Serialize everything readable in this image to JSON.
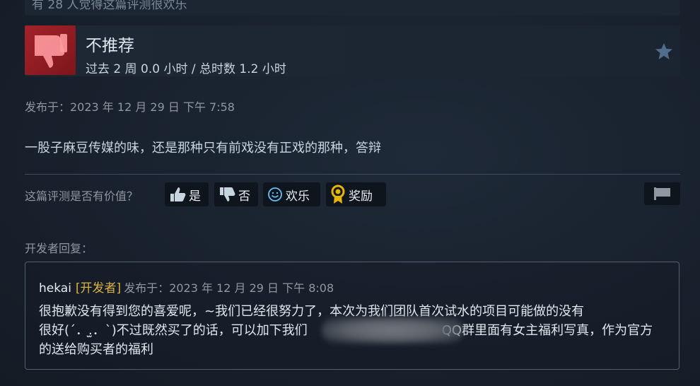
{
  "top_strip_text": "有 28 人觉得这篇评测很欢乐",
  "review": {
    "verdict": "不推荐",
    "hours": "过去 2 周 0.0 小时 / 总时数 1.2 小时",
    "posted": "发布于：2023 年 12 月 29 日 下午 7:58",
    "text": "一股子麻豆传媒的味，还是那种只有前戏没有正戏的那种，答辩"
  },
  "helpful": {
    "question": "这篇评测是否有价值？",
    "yes": "是",
    "no": "否",
    "funny": "欢乐",
    "award": "奖励"
  },
  "developer_response": {
    "label": "开发者回复：",
    "name": "hekai",
    "tag": "[开发者]",
    "posted": "发布于：2023 年 12 月 29 日 下午 8:08",
    "line1": "很抱歉没有得到您的喜爱呢，~我们已经很努力了，本次为我们团队首次试水的项目可能做的没有",
    "line2": "很好(´．.̫．`)不过既然买了的话，可以加下我们",
    "line2_tail": "QQ群里面有女主福利写真，作为官方",
    "line3": "的送给购买者的福利"
  },
  "colors": {
    "thumb_down_bg": "#a4232a",
    "developer_tag": "#d9b440",
    "award_icon": "#e8b400"
  },
  "icons": [
    "thumbs-down-icon",
    "star-icon",
    "thumbs-up-icon",
    "smile-icon",
    "award-icon",
    "flag-icon"
  ]
}
